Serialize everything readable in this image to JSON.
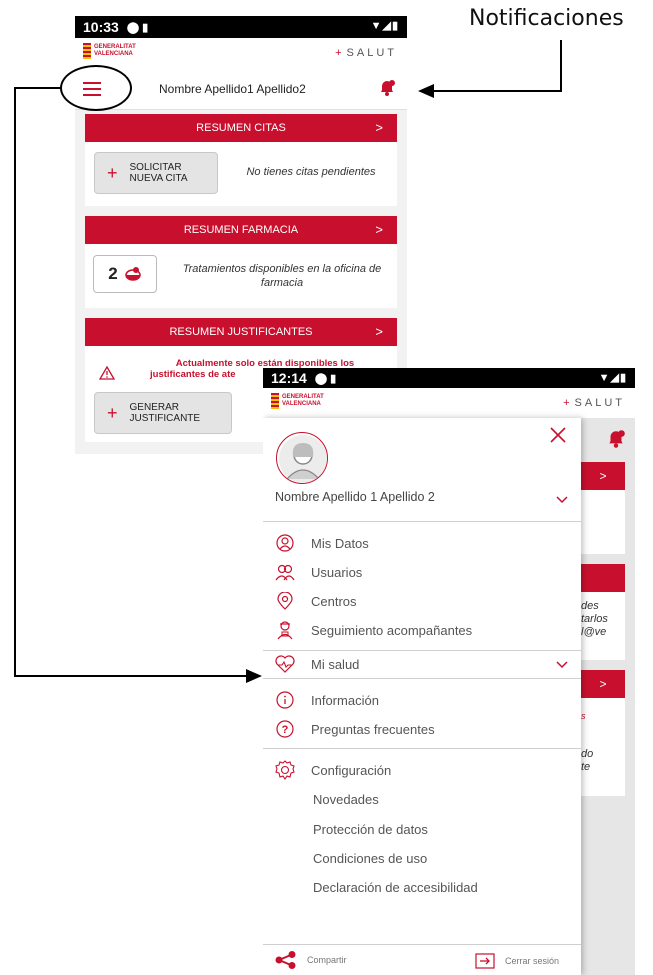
{
  "annotation": {
    "label": "Notificaciones"
  },
  "phone1": {
    "status": {
      "time": "10:33"
    },
    "brand": {
      "gv_line1": "GENERALITAT",
      "gv_line2": "VALENCIANA",
      "salut": "SALUT"
    },
    "header": {
      "user_name": "Nombre Apellido1 Apellido2"
    },
    "citas": {
      "title": "RESUMEN CITAS",
      "button_line1": "SOLICITAR",
      "button_line2": "NUEVA CITA",
      "message": "No tienes citas pendientes"
    },
    "farmacia": {
      "title": "RESUMEN FARMACIA",
      "count": "2",
      "message": "Tratamientos disponibles en la oficina de farmacia"
    },
    "justificantes": {
      "title": "RESUMEN JUSTIFICANTES",
      "warning_line1": "Actualmente solo están disponibles los",
      "warning_line2": "justificantes de ate",
      "button_line1": "GENERAR",
      "button_line2": "JUSTIFICANTE"
    }
  },
  "phone2": {
    "status": {
      "time": "12:14"
    },
    "brand": {
      "gv_line1": "GENERALITAT",
      "gv_line2": "VALENCIANA",
      "salut": "SALUT"
    },
    "drawer": {
      "user_name": "Nombre Apellido 1 Apellido 2",
      "items_group1": [
        {
          "label": "Mis Datos",
          "icon": "user-circle-icon"
        },
        {
          "label": "Usuarios",
          "icon": "users-icon"
        },
        {
          "label": "Centros",
          "icon": "location-pin-icon"
        },
        {
          "label": "Seguimiento acompañantes",
          "icon": "companion-icon"
        }
      ],
      "mi_salud": "Mi salud",
      "items_group2": [
        {
          "label": "Información",
          "icon": "info-icon"
        },
        {
          "label": "Preguntas frecuentes",
          "icon": "question-icon"
        }
      ],
      "configuracion": "Configuración",
      "subitems": [
        "Novedades",
        "Protección de datos",
        "Condiciones de uso",
        "Declaración de accesibilidad"
      ],
      "share": "Compartir",
      "logout": "Cerrar sesión"
    },
    "background_fragments": [
      "des",
      "tarlos",
      "l@ve",
      "s",
      "do",
      "te"
    ]
  },
  "colors": {
    "accent": "#c8102e",
    "background": "#f2f2f2"
  }
}
